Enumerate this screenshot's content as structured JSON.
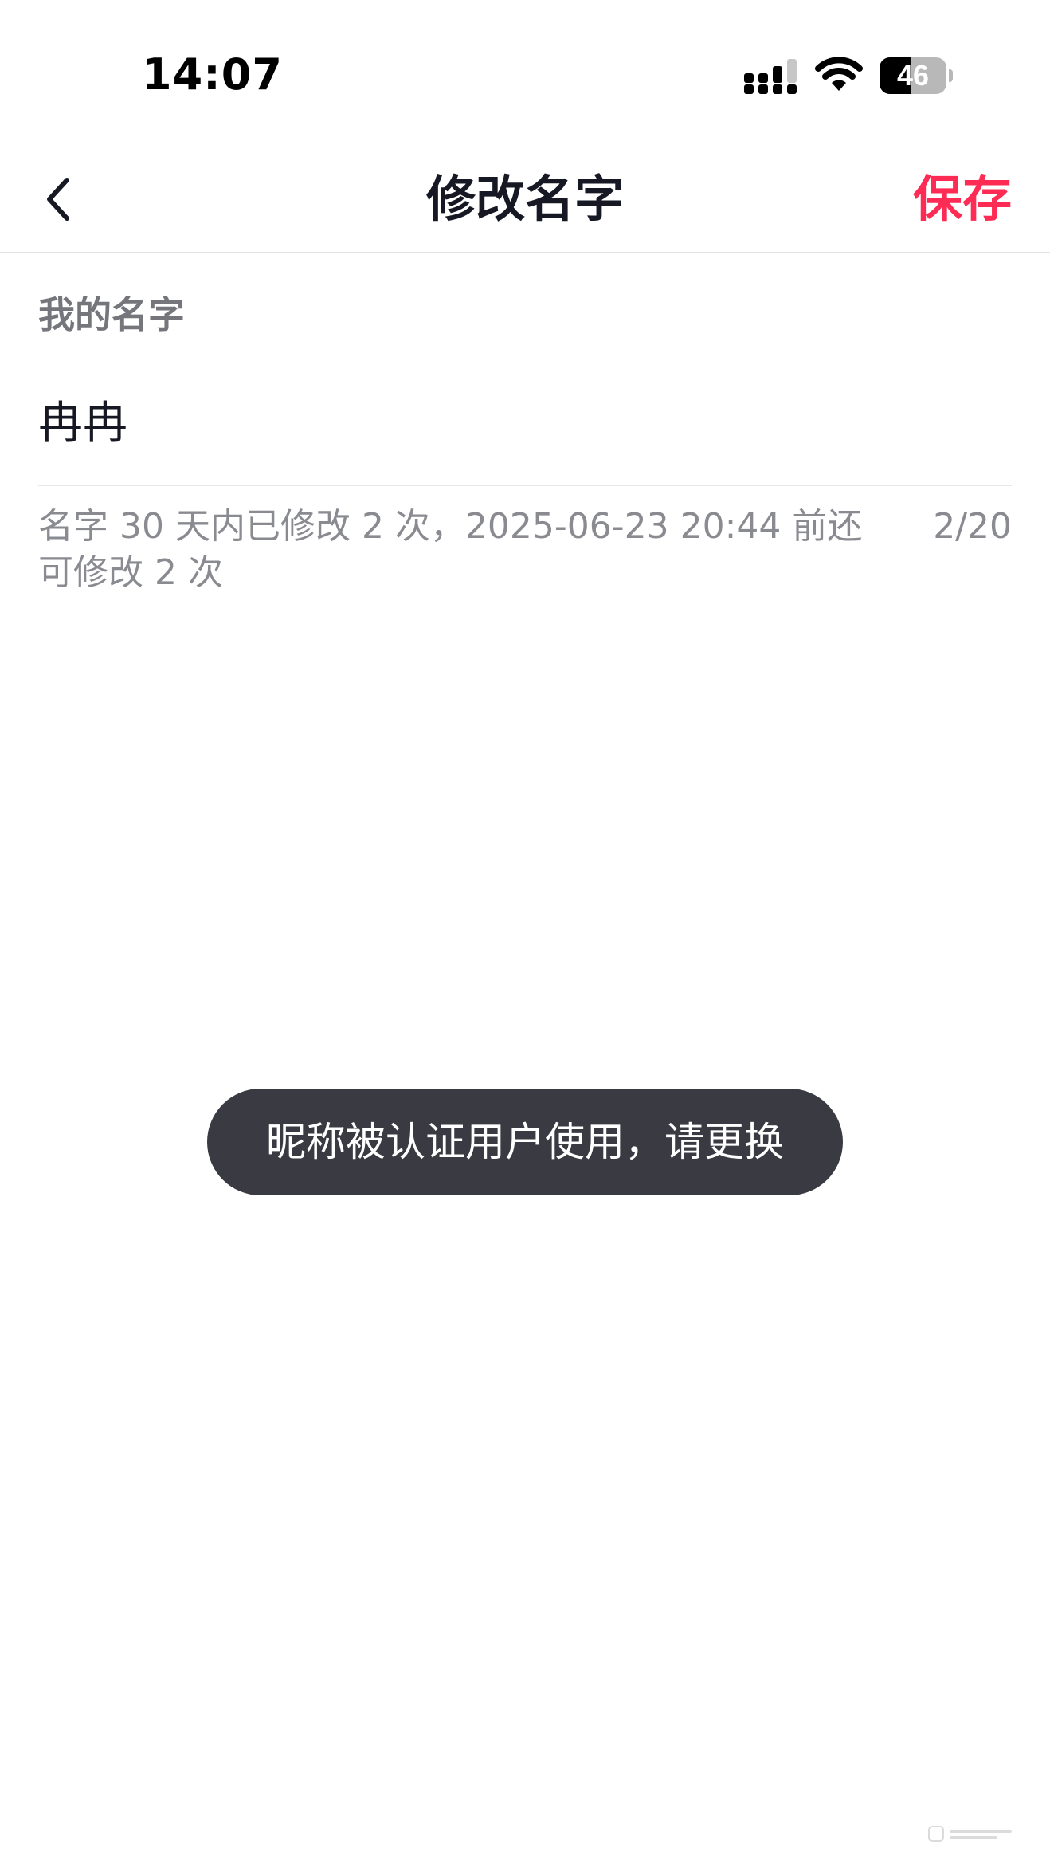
{
  "status_bar": {
    "time": "14:07",
    "battery_level": "46",
    "battery_fraction": 0.46,
    "icons": [
      "signal-icon",
      "wifi-icon",
      "battery-icon"
    ]
  },
  "nav": {
    "back_icon": "chevron-left-icon",
    "title": "修改名字",
    "save_label": "保存"
  },
  "form": {
    "label": "我的名字",
    "name_value": "冉冉",
    "hint": "名字 30 天内已修改 2 次，2025-06-23 20:44 前还可修改 2 次",
    "counter": "2/20"
  },
  "toast": {
    "message": "昵称被认证用户使用，请更换"
  },
  "colors": {
    "accent": "#fe2c55",
    "text_primary": "#161823",
    "text_secondary": "#8a8b91",
    "toast_bg": "#393a42",
    "divider": "#e3e3e4"
  }
}
